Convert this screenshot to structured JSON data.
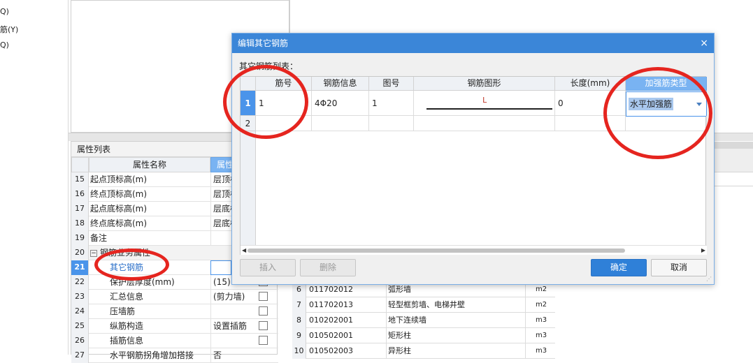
{
  "left_tree": {
    "items": [
      "Q)",
      "筋(Y)",
      "Q)"
    ]
  },
  "property_panel": {
    "title": "属性列表",
    "col_name": "属性名称",
    "col_value": "属性",
    "rows": [
      {
        "n": "15",
        "k": "起点顶标高(m)",
        "v": "层顶标",
        "chk": false
      },
      {
        "n": "16",
        "k": "终点顶标高(m)",
        "v": "层顶标",
        "chk": false
      },
      {
        "n": "17",
        "k": "起点底标高(m)",
        "v": "层底标",
        "chk": false
      },
      {
        "n": "18",
        "k": "终点底标高(m)",
        "v": "层底标",
        "chk": false
      },
      {
        "n": "19",
        "k": "备注",
        "v": "",
        "chk": false
      },
      {
        "n": "20",
        "k": "钢筋业务属性",
        "v": "",
        "chk": false
      },
      {
        "n": "21",
        "k": "其它钢筋",
        "v": "",
        "chk": false
      },
      {
        "n": "22",
        "k": "保护层厚度(mm)",
        "v": "(15)",
        "chk": true
      },
      {
        "n": "23",
        "k": "汇总信息",
        "v": "(剪力墙)",
        "chk": true
      },
      {
        "n": "24",
        "k": "压墙筋",
        "v": "",
        "chk": true
      },
      {
        "n": "25",
        "k": "纵筋构造",
        "v": "设置插筋",
        "chk": true
      },
      {
        "n": "26",
        "k": "插筋信息",
        "v": "",
        "chk": true
      },
      {
        "n": "27",
        "k": "水平钢筋拐角增加搭接",
        "v": "否",
        "chk": false
      }
    ]
  },
  "code_list": {
    "rows": [
      {
        "n": "6",
        "code": "011702012",
        "name": "弧形墙",
        "unit": "m2"
      },
      {
        "n": "7",
        "code": "011702013",
        "name": "轻型框剪墙、电梯井壁",
        "unit": "m2"
      },
      {
        "n": "8",
        "code": "010202001",
        "name": "地下连续墙",
        "unit": "m3"
      },
      {
        "n": "9",
        "code": "010502001",
        "name": "矩形柱",
        "unit": "m3"
      },
      {
        "n": "10",
        "code": "010502003",
        "name": "异形柱",
        "unit": "m3"
      }
    ]
  },
  "dialog": {
    "title": "编辑其它钢筋",
    "close": "×",
    "table_label": "其它钢筋列表：",
    "headers": [
      "筋号",
      "钢筋信息",
      "图号",
      "钢筋图形",
      "长度(mm)",
      "加强筋类型"
    ],
    "rows": [
      {
        "n": "1",
        "bar_no": "1",
        "bar_info": "4Φ20",
        "fig_no": "1",
        "shape_label": "L",
        "length": "0",
        "type": "水平加强筋"
      },
      {
        "n": "2",
        "bar_no": "",
        "bar_info": "",
        "fig_no": "",
        "shape_label": "",
        "length": "",
        "type": ""
      }
    ],
    "buttons": {
      "insert": "插入",
      "delete": "删除",
      "ok": "确定",
      "cancel": "取消"
    },
    "scroll_left": "◀",
    "scroll_right": "▶"
  },
  "colors": {
    "title_bar": "#3b86d8",
    "header_accent": "#79b3f2",
    "selection": "#4a94ea",
    "annotation": "#e5251f"
  }
}
